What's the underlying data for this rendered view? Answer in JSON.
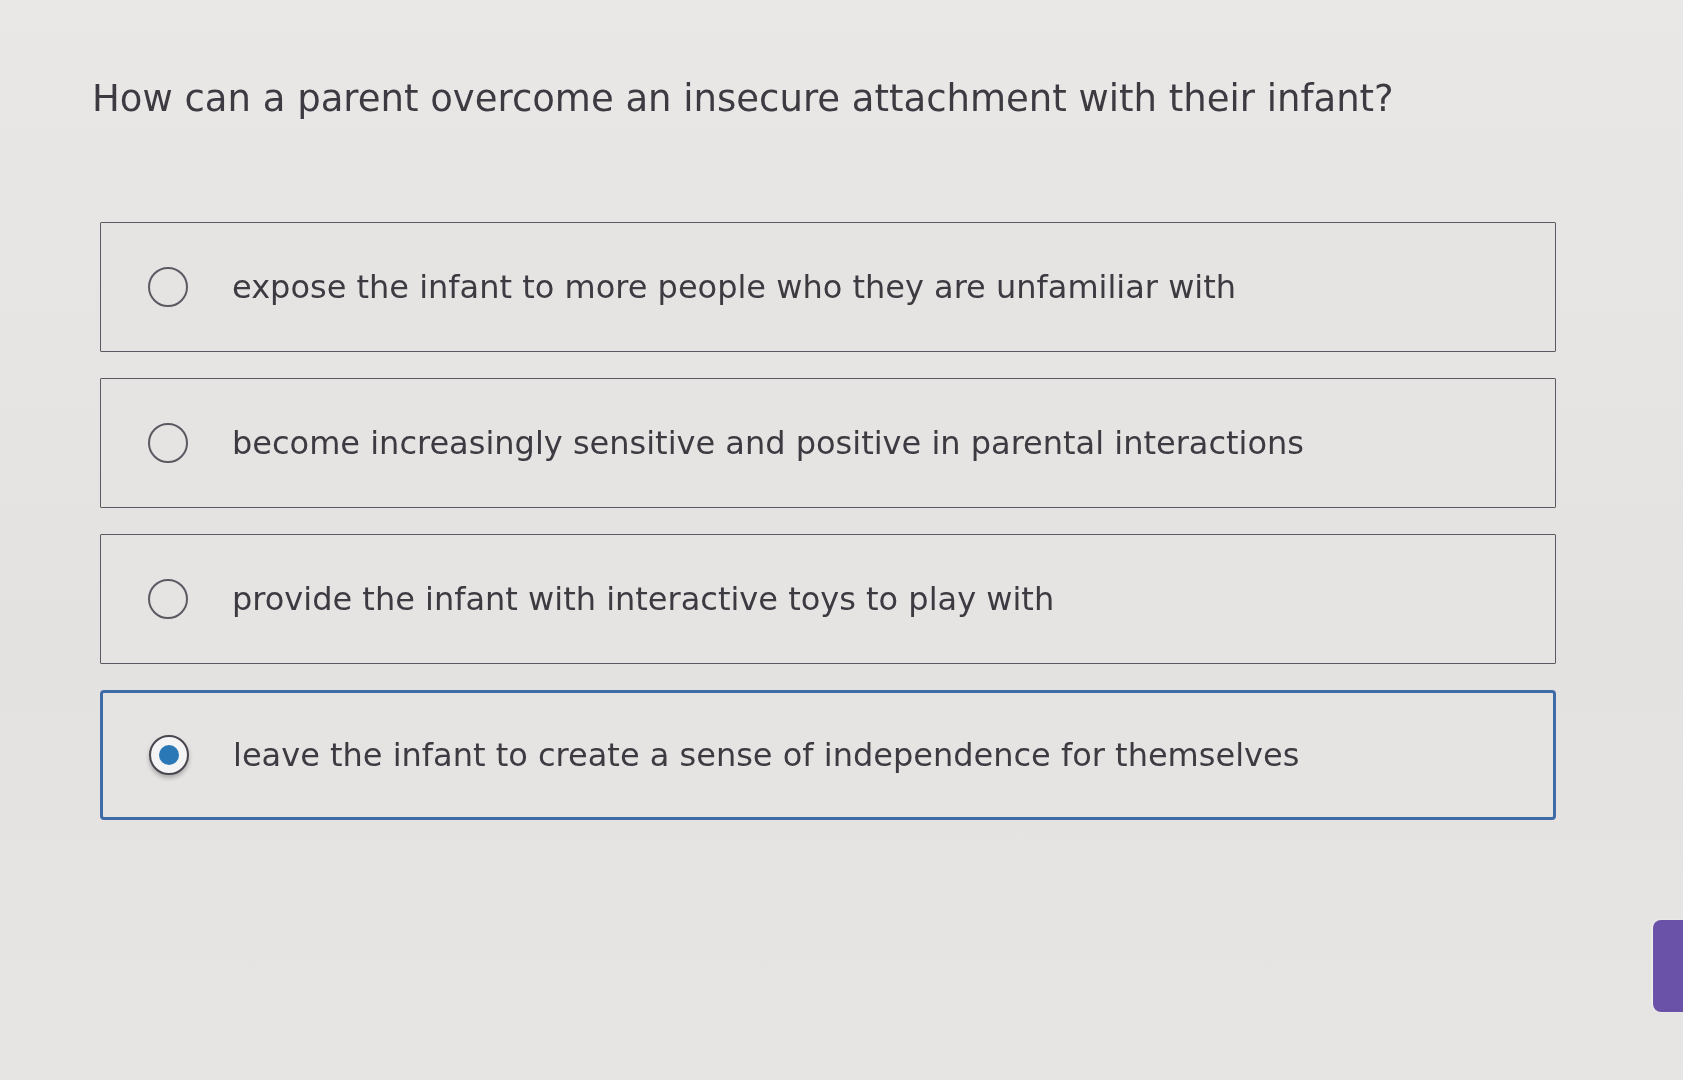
{
  "question": {
    "text": "How can a parent overcome an insecure attachment with their infant?"
  },
  "options": [
    {
      "label": "expose the infant to more people who they are unfamiliar with",
      "selected": false
    },
    {
      "label": "become increasingly sensitive and positive in parental interactions",
      "selected": false
    },
    {
      "label": "provide the infant with interactive toys to play with",
      "selected": false
    },
    {
      "label": "leave the infant to create a sense of independence for themselves",
      "selected": true
    }
  ]
}
